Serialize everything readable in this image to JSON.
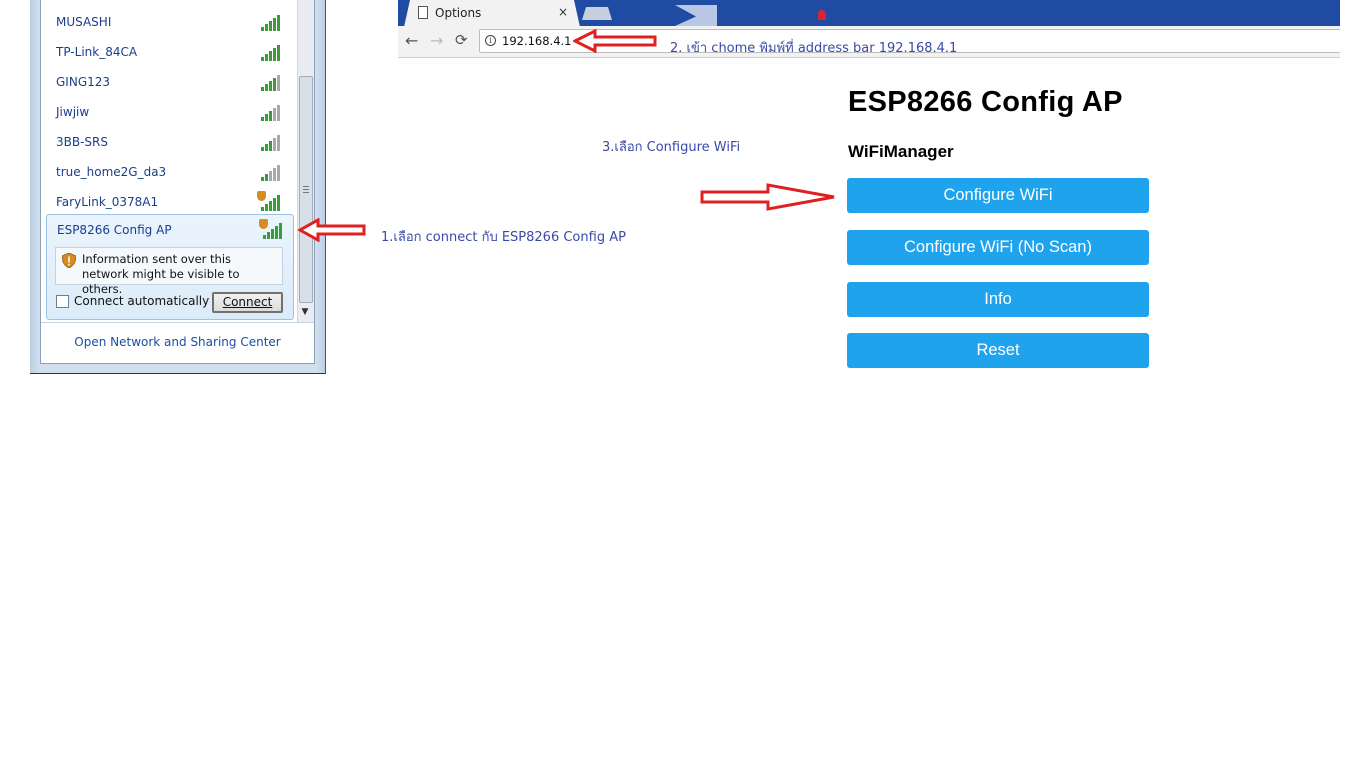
{
  "wifi_panel": {
    "networks": [
      {
        "name": "MUSASHI",
        "bars": 5,
        "secured": false
      },
      {
        "name": "TP-Link_84CA",
        "bars": 5,
        "secured": false
      },
      {
        "name": "GING123",
        "bars": 4,
        "secured": false
      },
      {
        "name": "Jiwjiw",
        "bars": 3,
        "secured": false
      },
      {
        "name": "3BB-SRS",
        "bars": 3,
        "secured": false
      },
      {
        "name": "true_home2G_da3",
        "bars": 2,
        "secured": false
      },
      {
        "name": "FaryLink_0378A1",
        "bars": 5,
        "secured": true
      }
    ],
    "selected_network": {
      "name": "ESP8266 Config AP",
      "bars": 5,
      "secured": true
    },
    "warning_text": "Information sent over this network might be visible to others.",
    "auto_connect_label": "Connect automatically",
    "auto_connect_checked": false,
    "connect_label": "Connect",
    "footer_link": "Open Network and Sharing Center"
  },
  "browser": {
    "tab_title": "Options",
    "tab_close": "×",
    "url": "192.168.4.1",
    "back": "←",
    "forward": "→",
    "reload": "⟳",
    "info_icon": "i"
  },
  "esp_page": {
    "title": "ESP8266 Config AP",
    "subtitle": "WiFiManager",
    "buttons": [
      "Configure WiFi",
      "Configure WiFi (No Scan)",
      "Info",
      "Reset"
    ],
    "button_color": "#1fa3ec"
  },
  "annotations": {
    "step1": "1.เลือก connect กับ ESP8266 Config AP",
    "step2": "2. เข้า chome พิมพ์ที่ address bar 192.168.4.1",
    "step3": "3.เลือก Configure WiFi",
    "arrow_color": "#e02020"
  }
}
